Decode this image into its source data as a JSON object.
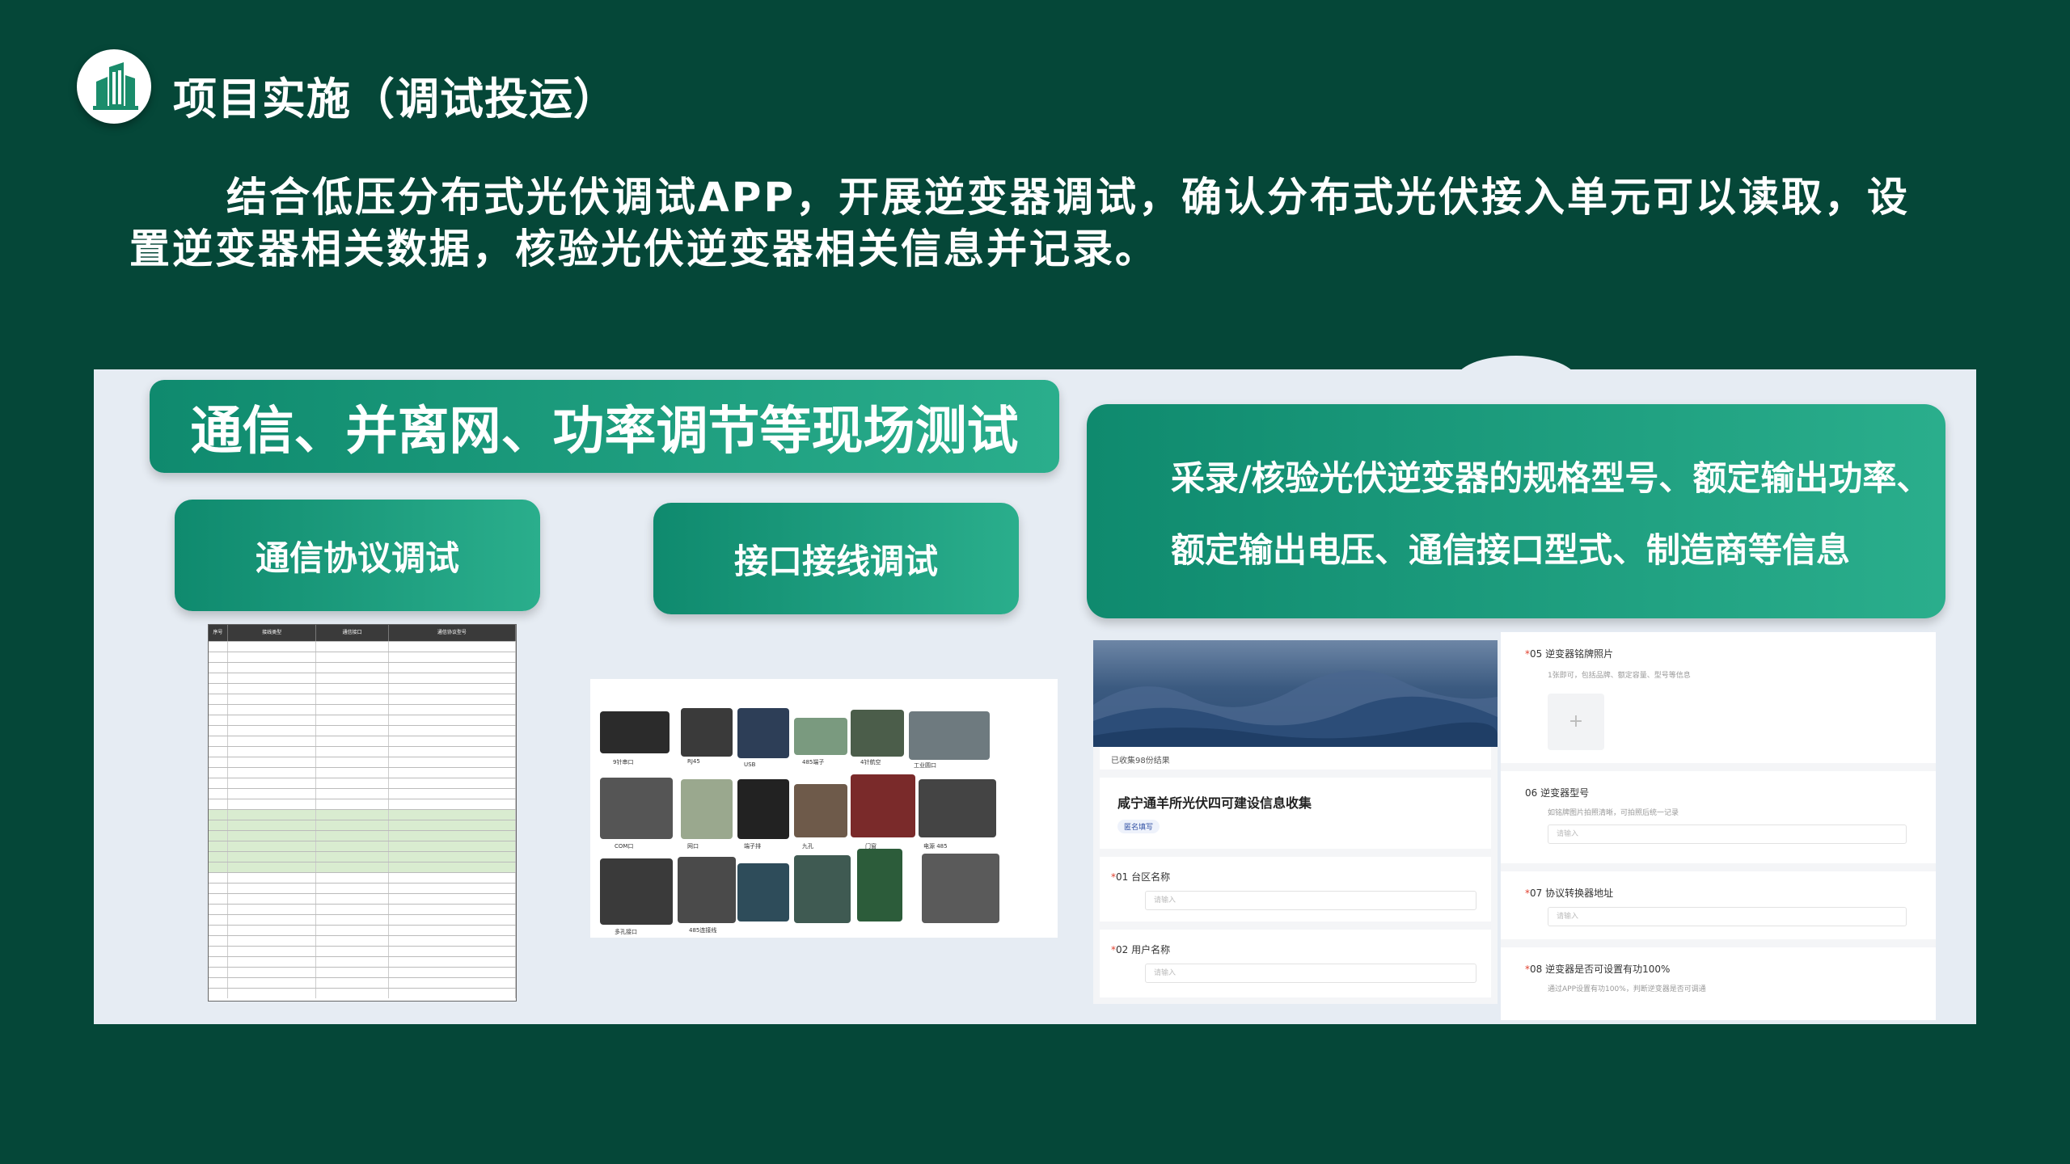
{
  "header": {
    "title": "项目实施（调试投运）"
  },
  "intro": "结合低压分布式光伏调试APP，开展逆变器调试，确认分布式光伏接入单元可以读取，设置逆变器相关数据，核验光伏逆变器相关信息并记录。",
  "left_section": {
    "main_heading": "通信、并离网、功率调节等现场测试",
    "sub_a": "通信协议调试",
    "sub_b": "接口接线调试"
  },
  "right_section": {
    "line1": "采录/核验光伏逆变器的规格型号、额定输出功率、",
    "line2": "额定输出电压、通信接口型式、制造商等信息"
  },
  "table_image": {
    "headers": [
      "序号",
      "接线类型",
      "通信接口",
      "通信协议型号"
    ]
  },
  "photo_captions": [
    "9针串口",
    "RJ45",
    "USB",
    "485端子",
    "4针航空",
    "工业圆口",
    "COM口",
    "网口",
    "端子排",
    "九孔",
    "门窗",
    "电源 485 ",
    "多孔接口",
    "485连接线"
  ],
  "form": {
    "collected": "已收集98份结果",
    "title": "咸宁通羊所光伏四可建设信息收集",
    "badge": "匿名填写",
    "q01": "01  台区名称",
    "q02": "02  用户名称",
    "q05": "05  逆变器铭牌照片",
    "q05_hint": "1张即可，包括品牌、额定容量、型号等信息",
    "q06": "06  逆变器型号",
    "q06_hint": "如铭牌图片拍照清晰，可拍照后统一记录",
    "q07": "07  协议转换器地址",
    "q08": "08  逆变器是否可设置有功100%",
    "q08_hint": "通过APP设置有功100%，判断逆变器是否可调通",
    "placeholder": "请输入",
    "required_mark": "*",
    "upload_plus": "+"
  }
}
